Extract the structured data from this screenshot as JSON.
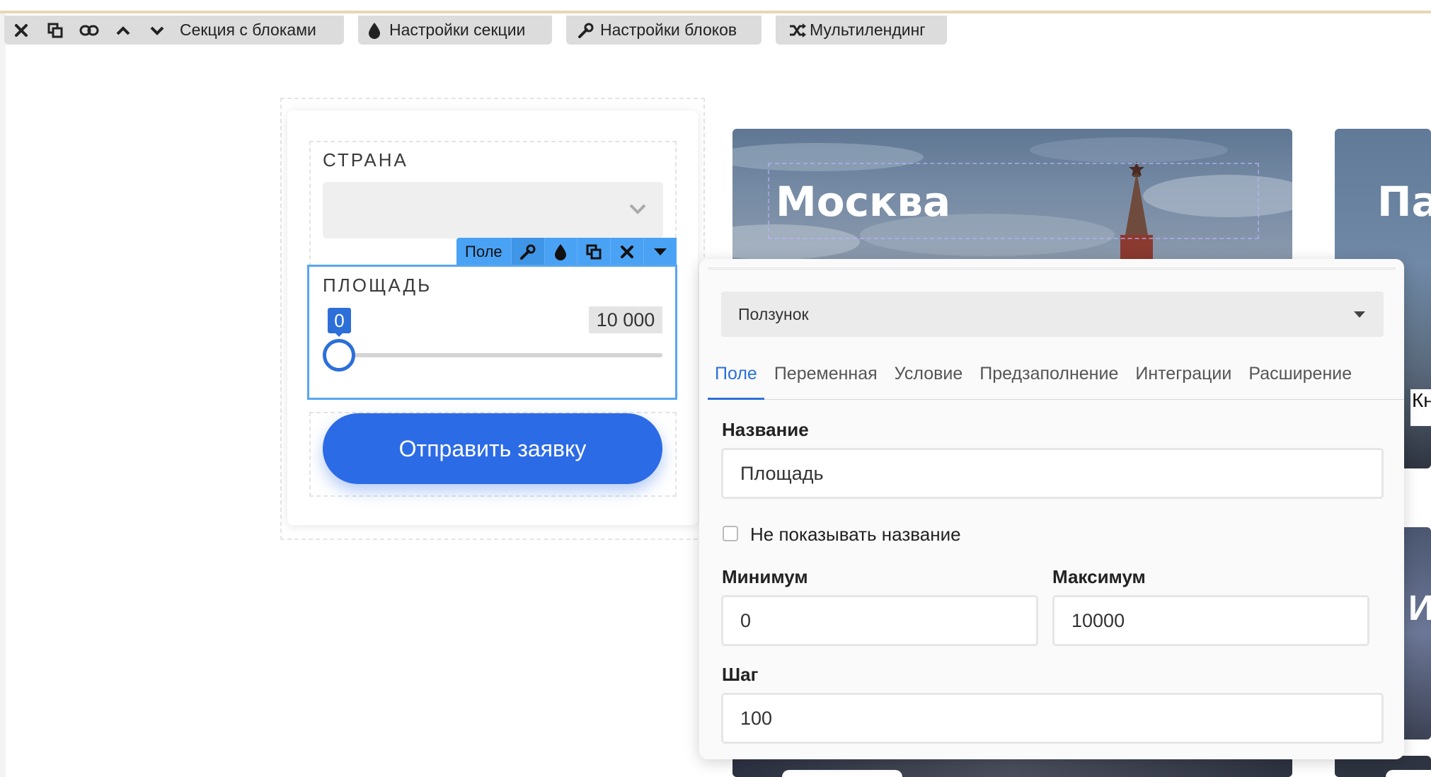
{
  "toolbar": {
    "section_label": "Секция с блоками",
    "section_settings": "Настройки секции",
    "block_settings": "Настройки блоков",
    "multilanding": "Мультилендинг"
  },
  "form": {
    "country_label": "СТРАНА",
    "area_label": "ПЛОЩАДЬ",
    "slider_min": "0",
    "slider_max": "10 000",
    "submit": "Отправить заявку",
    "field_toolbar_label": "Поле"
  },
  "cards": {
    "moscow": "Москва",
    "second_partial": "Пар",
    "third_partial": "Ид",
    "side_partial": "Кн"
  },
  "panel": {
    "type_value": "Ползунок",
    "tabs": [
      "Поле",
      "Переменная",
      "Условие",
      "Предзаполнение",
      "Интеграции",
      "Расширение"
    ],
    "name_label": "Название",
    "name_value": "Площадь",
    "hide_name_label": "Не показывать название",
    "min_label": "Минимум",
    "min_value": "0",
    "max_label": "Максимум",
    "max_value": "10000",
    "step_label": "Шаг",
    "step_value": "100"
  },
  "colors": {
    "accent": "#2c6fd9",
    "submit": "#2c6be6",
    "field_toolbar": "#4aa2f5"
  }
}
